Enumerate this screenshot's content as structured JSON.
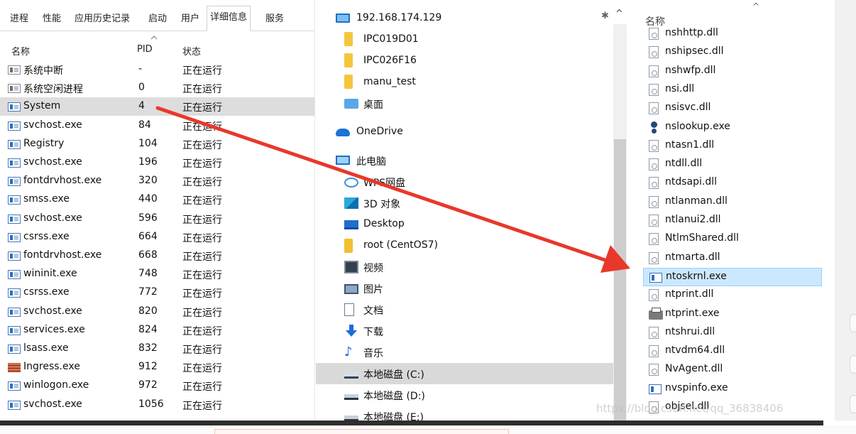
{
  "task_manager": {
    "tabs": [
      "进程",
      "性能",
      "应用历史记录",
      "启动",
      "用户",
      "详细信息",
      "服务"
    ],
    "active_tab": "详细信息",
    "columns": {
      "name": "名称",
      "pid": "PID",
      "status": "状态"
    },
    "rows": [
      {
        "name": "系统中断",
        "pid": "-",
        "status": "正在运行",
        "icon": "system-icon"
      },
      {
        "name": "系统空闲进程",
        "pid": "0",
        "status": "正在运行",
        "icon": "system-icon"
      },
      {
        "name": "System",
        "pid": "4",
        "status": "正在运行",
        "icon": "process-icon",
        "selected": true
      },
      {
        "name": "svchost.exe",
        "pid": "84",
        "status": "正在运行",
        "icon": "process-icon"
      },
      {
        "name": "Registry",
        "pid": "104",
        "status": "正在运行",
        "icon": "process-icon"
      },
      {
        "name": "svchost.exe",
        "pid": "196",
        "status": "正在运行",
        "icon": "process-icon"
      },
      {
        "name": "fontdrvhost.exe",
        "pid": "320",
        "status": "正在运行",
        "icon": "process-icon"
      },
      {
        "name": "smss.exe",
        "pid": "440",
        "status": "正在运行",
        "icon": "process-icon"
      },
      {
        "name": "svchost.exe",
        "pid": "596",
        "status": "正在运行",
        "icon": "process-icon"
      },
      {
        "name": "csrss.exe",
        "pid": "664",
        "status": "正在运行",
        "icon": "process-icon"
      },
      {
        "name": "fontdrvhost.exe",
        "pid": "668",
        "status": "正在运行",
        "icon": "process-icon"
      },
      {
        "name": "wininit.exe",
        "pid": "748",
        "status": "正在运行",
        "icon": "process-icon"
      },
      {
        "name": "csrss.exe",
        "pid": "772",
        "status": "正在运行",
        "icon": "process-icon"
      },
      {
        "name": "svchost.exe",
        "pid": "820",
        "status": "正在运行",
        "icon": "process-icon"
      },
      {
        "name": "services.exe",
        "pid": "824",
        "status": "正在运行",
        "icon": "process-icon"
      },
      {
        "name": "lsass.exe",
        "pid": "832",
        "status": "正在运行",
        "icon": "process-icon"
      },
      {
        "name": "Ingress.exe",
        "pid": "912",
        "status": "正在运行",
        "icon": "brick-icon"
      },
      {
        "name": "winlogon.exe",
        "pid": "972",
        "status": "正在运行",
        "icon": "process-icon"
      },
      {
        "name": "svchost.exe",
        "pid": "1056",
        "status": "正在运行",
        "icon": "process-icon"
      }
    ]
  },
  "explorer_nav": {
    "items": [
      {
        "label": "192.168.174.129",
        "icon": "network-monitor-icon",
        "level": "top"
      },
      {
        "label": "IPC019D01",
        "icon": "folder-icon",
        "level": "child"
      },
      {
        "label": "IPC026F16",
        "icon": "folder-icon",
        "level": "child"
      },
      {
        "label": "manu_test",
        "icon": "folder-icon",
        "level": "child"
      },
      {
        "label": "桌面",
        "icon": "desktop-folder-icon",
        "level": "child"
      },
      {
        "label": "OneDrive",
        "icon": "onedrive-cloud-icon",
        "level": "top"
      },
      {
        "label": "此电脑",
        "icon": "this-pc-icon",
        "level": "top"
      },
      {
        "label": "WPS网盘",
        "icon": "wps-cloud-icon",
        "level": "child"
      },
      {
        "label": "3D 对象",
        "icon": "3d-objects-icon",
        "level": "child"
      },
      {
        "label": "Desktop",
        "icon": "desktop-icon",
        "level": "child"
      },
      {
        "label": "root (CentOS7)",
        "icon": "linux-share-icon",
        "level": "child"
      },
      {
        "label": "视频",
        "icon": "video-icon",
        "level": "child"
      },
      {
        "label": "图片",
        "icon": "pictures-icon",
        "level": "child"
      },
      {
        "label": "文档",
        "icon": "documents-icon",
        "level": "child"
      },
      {
        "label": "下载",
        "icon": "download-arrow-icon",
        "level": "child"
      },
      {
        "label": "音乐",
        "icon": "music-note-icon",
        "level": "child"
      },
      {
        "label": "本地磁盘 (C:)",
        "icon": "system-drive-icon",
        "level": "child",
        "selected": true
      },
      {
        "label": "本地磁盘 (D:)",
        "icon": "drive-icon",
        "level": "child"
      },
      {
        "label": "本地磁盘 (E:)",
        "icon": "drive-icon",
        "level": "child"
      }
    ]
  },
  "file_list": {
    "column_header": "名称",
    "items": [
      {
        "name": "nshhttp.dll",
        "icon": "dll-icon"
      },
      {
        "name": "nshipsec.dll",
        "icon": "dll-icon"
      },
      {
        "name": "nshwfp.dll",
        "icon": "dll-icon"
      },
      {
        "name": "nsi.dll",
        "icon": "dll-icon"
      },
      {
        "name": "nsisvc.dll",
        "icon": "dll-icon"
      },
      {
        "name": "nslookup.exe",
        "icon": "person-exe-icon"
      },
      {
        "name": "ntasn1.dll",
        "icon": "dll-icon"
      },
      {
        "name": "ntdll.dll",
        "icon": "dll-icon"
      },
      {
        "name": "ntdsapi.dll",
        "icon": "dll-icon"
      },
      {
        "name": "ntlanman.dll",
        "icon": "dll-icon"
      },
      {
        "name": "ntlanui2.dll",
        "icon": "dll-icon"
      },
      {
        "name": "NtlmShared.dll",
        "icon": "dll-icon"
      },
      {
        "name": "ntmarta.dll",
        "icon": "dll-icon"
      },
      {
        "name": "ntoskrnl.exe",
        "icon": "exe-icon",
        "selected": true
      },
      {
        "name": "ntprint.dll",
        "icon": "dll-icon"
      },
      {
        "name": "ntprint.exe",
        "icon": "printer-icon"
      },
      {
        "name": "ntshrui.dll",
        "icon": "dll-icon"
      },
      {
        "name": "ntvdm64.dll",
        "icon": "dll-icon"
      },
      {
        "name": "NvAgent.dll",
        "icon": "dll-icon"
      },
      {
        "name": "nvspinfo.exe",
        "icon": "exe-icon"
      },
      {
        "name": "objsel.dll",
        "icon": "dll-icon"
      }
    ]
  },
  "watermark": "https://blog.csdn.net/qq_36838406",
  "colors": {
    "arrow": "#e8382a",
    "selection": "#cce8ff",
    "row_selected": "#dddddd"
  }
}
